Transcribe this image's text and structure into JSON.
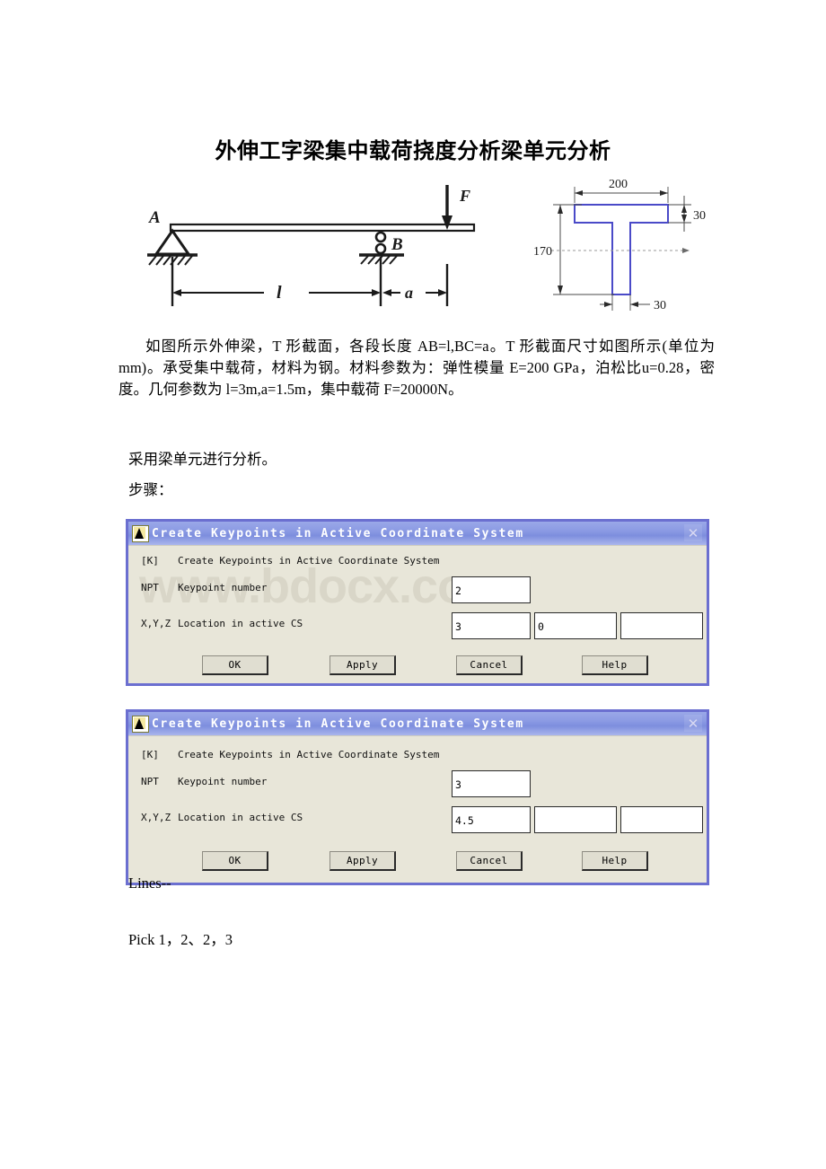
{
  "document": {
    "title": "外伸工字梁集中载荷挠度分析梁单元分析",
    "body_paragraph": "如图所示外伸梁，T 形截面，各段长度 AB=l,BC=a。T 形截面尺寸如图所示(单位为 mm)。承受集中载荷，材料为钢。材料参数为：弹性模量 E=200 GPa，泊松比u=0.28，密度。几何参数为 l=3m,a=1.5m，集中载荷 F=20000N。",
    "method_line": "采用梁单元进行分析。",
    "steps_label": "步骤：",
    "lines_label": "Lines--",
    "pick_label": "Pick 1，2、2，3"
  },
  "beam_figure": {
    "support_a_label": "A",
    "support_b_label": "B",
    "force_label": "F",
    "span_label": "l",
    "overhang_label": "a"
  },
  "section_figure": {
    "flange_width": "200",
    "flange_thickness": "30",
    "total_height": "170",
    "web_thickness": "30",
    "outline_color": "#4a4ac8"
  },
  "dialogs": [
    {
      "title": "Create Keypoints in Active Coordinate System",
      "command_tag": "[K]",
      "command_text": "Create Keypoints in Active Coordinate System",
      "npt_tag": "NPT",
      "npt_label": "Keypoint number",
      "npt_value": "2",
      "xyz_tag": "X,Y,Z",
      "xyz_label": "Location in active CS",
      "x_value": "3",
      "y_value": "0",
      "z_value": "",
      "buttons": [
        "OK",
        "Apply",
        "Cancel",
        "Help"
      ],
      "close_glyph": "✕",
      "watermark": "www.bdocx.com"
    },
    {
      "title": "Create Keypoints in Active Coordinate System",
      "command_tag": "[K]",
      "command_text": "Create Keypoints in Active Coordinate System",
      "npt_tag": "NPT",
      "npt_label": "Keypoint number",
      "npt_value": "3",
      "xyz_tag": "X,Y,Z",
      "xyz_label": "Location in active CS",
      "x_value": "4.5",
      "y_value": "",
      "z_value": "",
      "buttons": [
        "OK",
        "Apply",
        "Cancel",
        "Help"
      ],
      "close_glyph": "✕",
      "watermark": ""
    }
  ]
}
